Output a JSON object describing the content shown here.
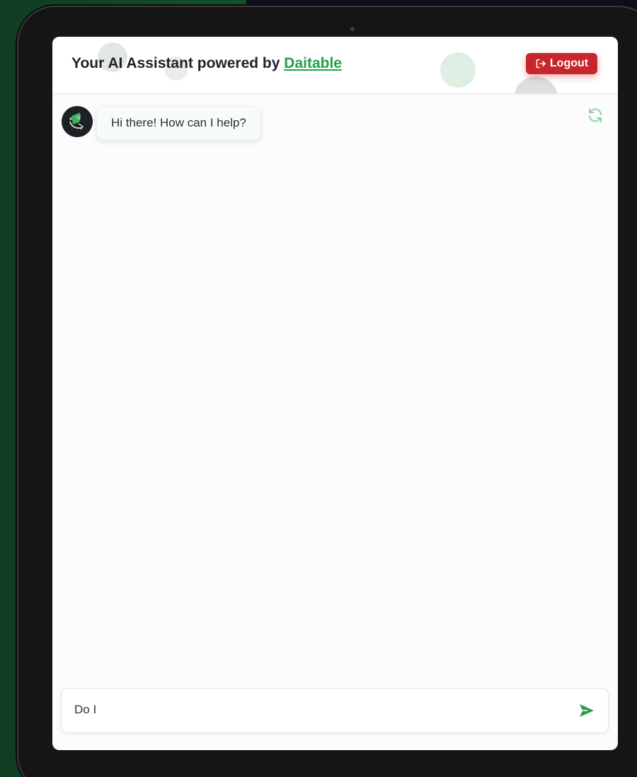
{
  "header": {
    "title_prefix": "Your AI Assistant powered by ",
    "brand_link": "Daitable",
    "logout_label": "Logout"
  },
  "chat": {
    "messages": [
      {
        "role": "assistant",
        "text": "Hi there! How can I help?"
      }
    ]
  },
  "composer": {
    "value": "Do I"
  },
  "icons": {
    "logout": "logout-icon",
    "refresh": "refresh-icon",
    "avatar": "assistant-avatar",
    "send": "send-icon"
  },
  "colors": {
    "brand_green": "#22a04b",
    "logout_red": "#c7262c",
    "background_green": "#145a30",
    "device_frame": "#151515"
  }
}
